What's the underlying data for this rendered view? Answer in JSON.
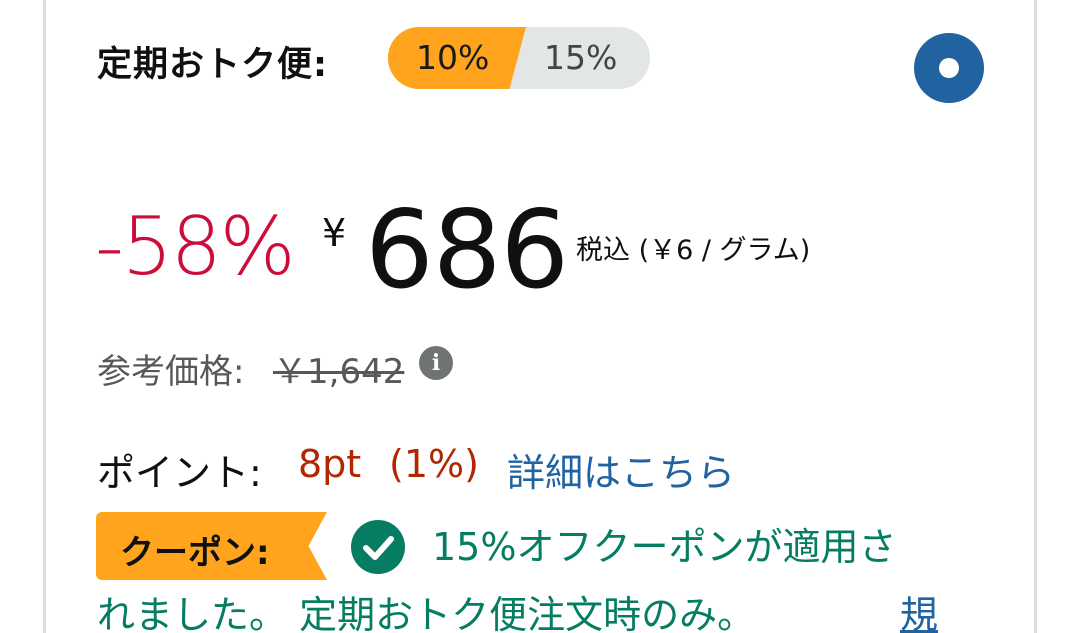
{
  "subscribe_save": {
    "label": "定期おトク便:",
    "tier_active": "10%",
    "tier_inactive": "15%",
    "colors": {
      "active_tier": "#ffa41c",
      "inactive_tier": "#e3e6e6",
      "radio": "#2162a1"
    }
  },
  "price": {
    "discount": "-58%",
    "currency_symbol": "¥",
    "amount": "686",
    "tax_note": "税込 (￥6 / グラム)",
    "colors": {
      "discount": "#cc0c39"
    }
  },
  "list_price": {
    "label": "参考価格:",
    "value": "￥1,642",
    "info_icon": "info-icon"
  },
  "points": {
    "label": "ポイント:",
    "value": "8pt",
    "percent": "(1%)",
    "details_link": "詳細はこちら",
    "colors": {
      "value": "#b12704",
      "link": "#2162a1"
    }
  },
  "coupon": {
    "badge_label": "クーポン:",
    "applied_text_line1": "15%オフクーポンが適用さ",
    "applied_text_line2": "れました。 定期おトク便注文時のみ。",
    "terms_link": "規",
    "icon": "check-circle-icon",
    "colors": {
      "badge": "#ffa41c",
      "text": "#067d62"
    }
  }
}
